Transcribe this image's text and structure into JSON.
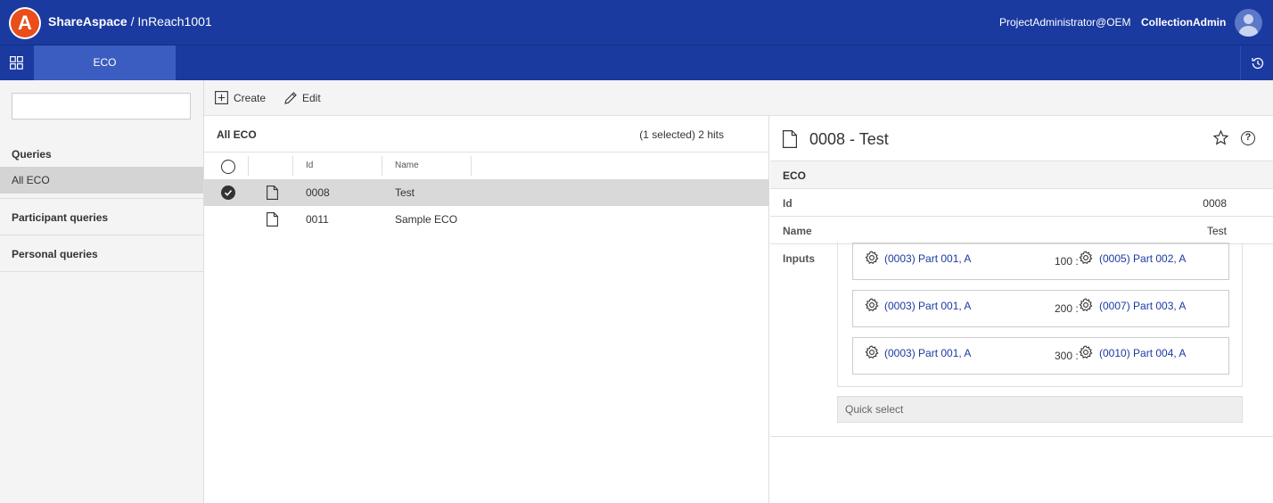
{
  "header": {
    "logo_letter": "A",
    "brand": "ShareAspace",
    "separator": " / ",
    "project": "InReach1001",
    "user": "ProjectAdministrator@OEM",
    "role": "CollectionAdmin"
  },
  "nav": {
    "tabs": [
      {
        "label": "ECO",
        "active": true
      }
    ]
  },
  "sidebar": {
    "search_value": "",
    "sections": [
      {
        "heading": "Queries",
        "items": [
          {
            "label": "All ECO",
            "selected": true
          }
        ]
      },
      {
        "heading": "Participant queries",
        "items": []
      },
      {
        "heading": "Personal queries",
        "items": []
      }
    ]
  },
  "toolbar": {
    "create_label": "Create",
    "edit_label": "Edit"
  },
  "list": {
    "title": "All ECO",
    "hits": "(1 selected) 2 hits",
    "columns": [
      "Id",
      "Name"
    ],
    "rows": [
      {
        "id": "0008",
        "name": "Test",
        "selected": true
      },
      {
        "id": "0011",
        "name": "Sample ECO",
        "selected": false
      }
    ]
  },
  "detail": {
    "title": "0008 - Test",
    "section": "ECO",
    "properties": [
      {
        "label": "Id",
        "value": "0008"
      },
      {
        "label": "Name",
        "value": "Test"
      }
    ],
    "inputs_label": "Inputs",
    "inputs": [
      {
        "from": "(0003) Part 001, A",
        "qty": "100 :",
        "to": "(0005) Part 002, A"
      },
      {
        "from": "(0003) Part 001, A",
        "qty": "200 :",
        "to": "(0007) Part 003, A"
      },
      {
        "from": "(0003) Part 001, A",
        "qty": "300 :",
        "to": "(0010) Part 004, A"
      }
    ],
    "quick_select_placeholder": "Quick select"
  },
  "colors": {
    "header_bg": "#1a3aa0",
    "active_tab": "#3b5dc1",
    "logo": "#e94e1b",
    "link": "#1a3aa0",
    "selected_row": "#d9d9d9"
  },
  "icons": [
    "logo-icon",
    "avatar-icon",
    "apps-grid-icon",
    "history-icon",
    "plus-square-icon",
    "pencil-icon",
    "document-icon",
    "star-icon",
    "help-icon",
    "gear-icon"
  ]
}
